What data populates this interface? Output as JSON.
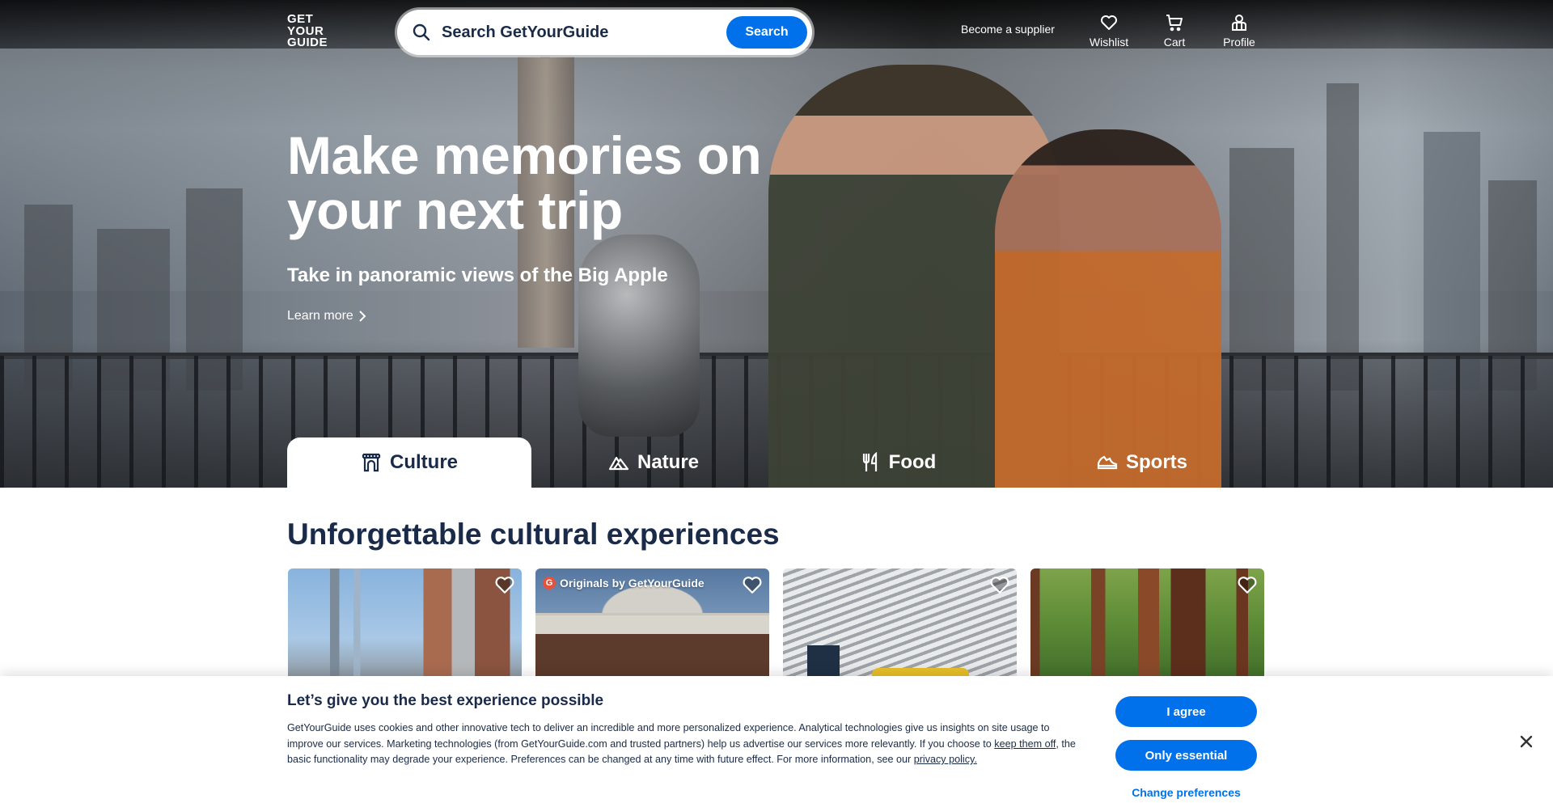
{
  "header": {
    "logo_lines": [
      "GET",
      "YOUR",
      "GUIDE"
    ],
    "search": {
      "placeholder": "Search GetYourGuide",
      "button_label": "Search",
      "icon": "search-icon"
    },
    "supplier_link": "Become a supplier",
    "nav": [
      {
        "label": "Wishlist",
        "icon": "heart-icon"
      },
      {
        "label": "Cart",
        "icon": "cart-icon"
      },
      {
        "label": "Profile",
        "icon": "profile-icon"
      }
    ]
  },
  "hero": {
    "headline": "Make memories on your next trip",
    "subheadline": "Take in panoramic views of the Big Apple",
    "learn_more": "Learn more"
  },
  "categories": [
    {
      "label": "Culture",
      "icon": "culture-icon",
      "active": true
    },
    {
      "label": "Nature",
      "icon": "mountain-icon",
      "active": false
    },
    {
      "label": "Food",
      "icon": "fork-knife-icon",
      "active": false
    },
    {
      "label": "Sports",
      "icon": "sports-icon",
      "active": false
    }
  ],
  "section": {
    "title": "Unforgettable cultural experiences",
    "cards": [
      {
        "badge": null,
        "image": "city skyline"
      },
      {
        "badge": "Originals by GetYourGuide",
        "badge_icon_letter": "G",
        "image": "neoclassical building"
      },
      {
        "badge": null,
        "image": "aircraft carrier hangar"
      },
      {
        "badge": null,
        "image": "redwood forest"
      }
    ]
  },
  "cookie_banner": {
    "title": "Let’s give you the best experience possible",
    "text_part1": "GetYourGuide uses cookies and other innovative tech to deliver an incredible and more personalized experience. Analytical technologies give us insights on site usage to improve our services. Marketing technologies (from GetYourGuide.com and trusted partners) help us advertise our services more relevantly. If you choose to ",
    "keep_off_link": "keep them off",
    "text_part2": ", the basic functionality may degrade your experience. Preferences can be changed at any time with future effect. For more information, see our ",
    "privacy_link": "privacy policy.",
    "agree_label": "I agree",
    "essential_label": "Only essential",
    "change_prefs_label": "Change preferences"
  },
  "colors": {
    "brand_blue": "#0071eb",
    "text_navy": "#1a2b49",
    "originals_badge": "#e5533d"
  }
}
